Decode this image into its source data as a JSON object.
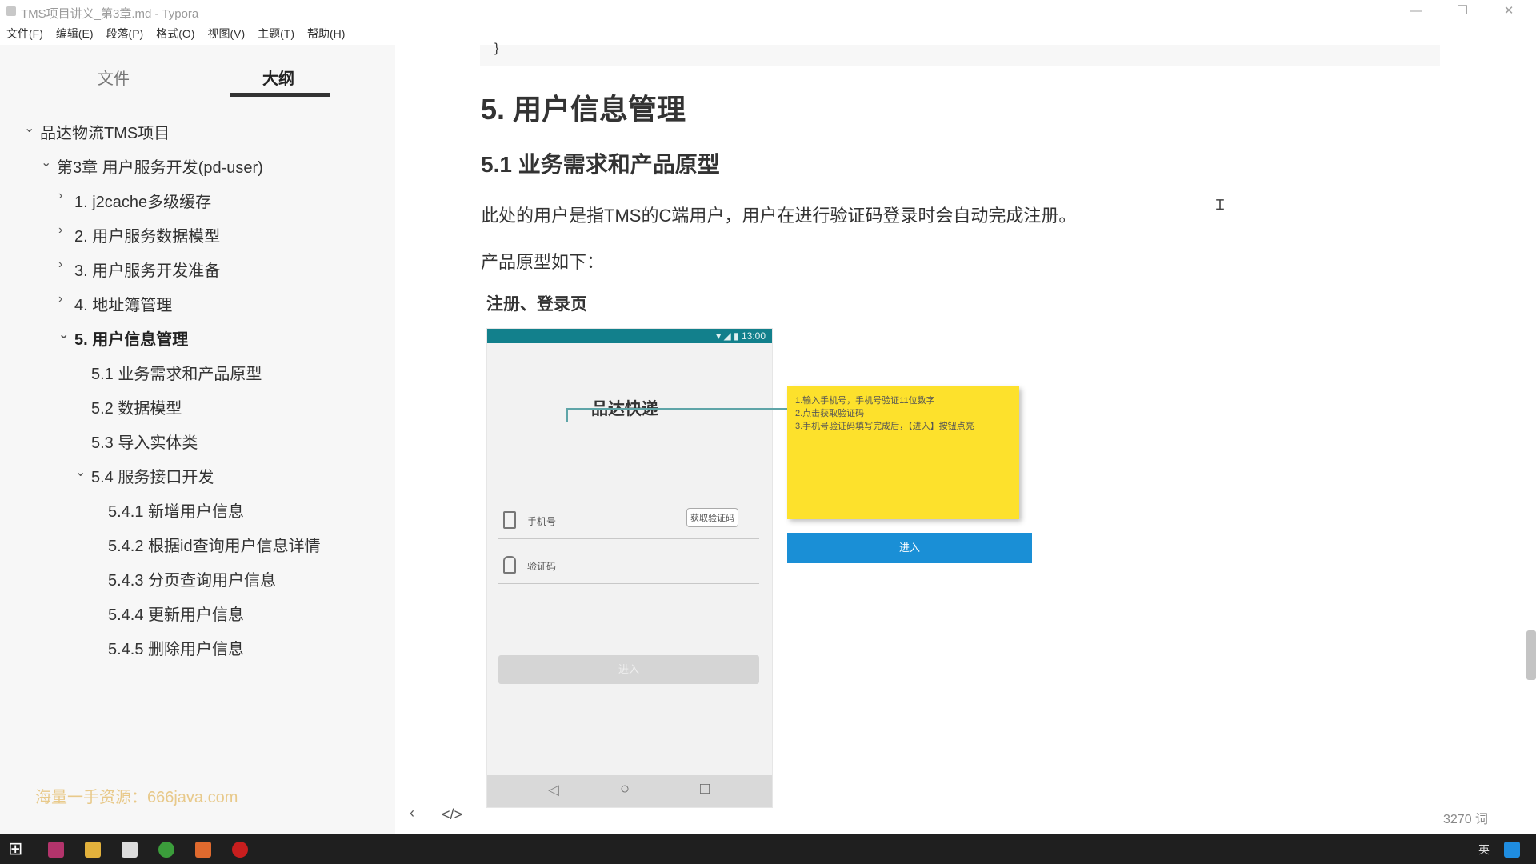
{
  "window": {
    "title": "TMS项目讲义_第3章.md - Typora",
    "minimize": "—",
    "restore": "❐",
    "close": "✕"
  },
  "menu": [
    "文件(F)",
    "编辑(E)",
    "段落(P)",
    "格式(O)",
    "视图(V)",
    "主题(T)",
    "帮助(H)"
  ],
  "sidebar": {
    "tabs": [
      "文件",
      "大纲"
    ],
    "outline": [
      {
        "label": "品达物流TMS项目",
        "chev": "⌄"
      },
      {
        "label": "第3章 用户服务开发(pd-user)",
        "chev": "⌄"
      },
      {
        "label": "1. j2cache多级缓存",
        "chev": "›"
      },
      {
        "label": "2. 用户服务数据模型",
        "chev": "›"
      },
      {
        "label": "3. 用户服务开发准备",
        "chev": "›"
      },
      {
        "label": "4. 地址簿管理",
        "chev": "›"
      },
      {
        "label": "5. 用户信息管理",
        "chev": "⌄"
      },
      {
        "label": "5.1 业务需求和产品原型",
        "chev": ""
      },
      {
        "label": "5.2 数据模型",
        "chev": ""
      },
      {
        "label": "5.3 导入实体类",
        "chev": ""
      },
      {
        "label": "5.4 服务接口开发",
        "chev": "⌄"
      },
      {
        "label": "5.4.1 新增用户信息",
        "chev": ""
      },
      {
        "label": "5.4.2 根据id查询用户信息详情",
        "chev": ""
      },
      {
        "label": "5.4.3 分页查询用户信息",
        "chev": ""
      },
      {
        "label": "5.4.4 更新用户信息",
        "chev": ""
      },
      {
        "label": "5.4.5 删除用户信息",
        "chev": ""
      }
    ],
    "watermark": "海量一手资源：666java.com"
  },
  "doc": {
    "code_tail": "}",
    "h2": "5. 用户信息管理",
    "h3": "5.1 业务需求和产品原型",
    "p1": "此处的用户是指TMS的C端用户，用户在进行验证码登录时会自动完成注册。",
    "p2": "产品原型如下：",
    "caption": "注册、登录页",
    "phone": {
      "status_time": "▾ ◢ ▮ 13:00",
      "brand": "品达快递",
      "phone_label": "手机号",
      "get_code": "获取验证码",
      "code_label": "验证码",
      "login": "进入",
      "nav_back": "◁",
      "nav_home": "○",
      "nav_recent": "□"
    },
    "sticky": [
      "1.输入手机号，手机号验证11位数字",
      "2.点击获取验证码",
      "3.手机号验证码填写完成后，【进入】按钮点亮"
    ],
    "enter": "进入"
  },
  "footer": {
    "prev": "‹",
    "source": "</>",
    "word_count": "3270 词"
  },
  "taskbar": {
    "start": "⊞",
    "ime": "英"
  }
}
